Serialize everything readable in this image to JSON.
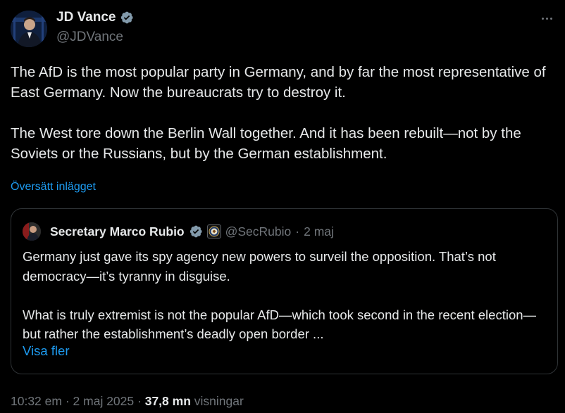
{
  "author": {
    "name": "JD Vance",
    "handle": "@JDVance"
  },
  "tweet": {
    "paragraphs": [
      "The AfD is the most popular party in Germany, and by far the most representative of East Germany. Now the bureaucrats try to destroy it.",
      "The West tore down the Berlin Wall together. And it has been rebuilt—not by the Soviets or the Russians, but by the German establishment."
    ],
    "translate_label": "Översätt inlägget"
  },
  "quote": {
    "name": "Secretary Marco Rubio",
    "handle": "@SecRubio",
    "separator": "·",
    "date": "2 maj",
    "paragraphs": [
      "Germany just gave its spy agency new powers to surveil the opposition.  That’s not democracy—it’s tyranny in disguise.",
      "What is truly extremist is not the popular AfD—which took second in the recent election—but rather the establishment’s deadly open border ..."
    ],
    "show_more_label": "Visa fler"
  },
  "meta": {
    "time": "10:32 em",
    "sep1": "·",
    "date": "2 maj 2025",
    "sep2": "·",
    "views_count": "37,8 mn",
    "views_label": "visningar"
  },
  "colors": {
    "background": "#000000",
    "text": "#e7e9ea",
    "muted": "#71767b",
    "link": "#1d9bf0",
    "verified": "#829aab",
    "border": "#2f3336"
  },
  "icons": {
    "verified": "verified-badge-icon",
    "more": "more-options-icon",
    "agency": "state-department-seal-icon"
  }
}
